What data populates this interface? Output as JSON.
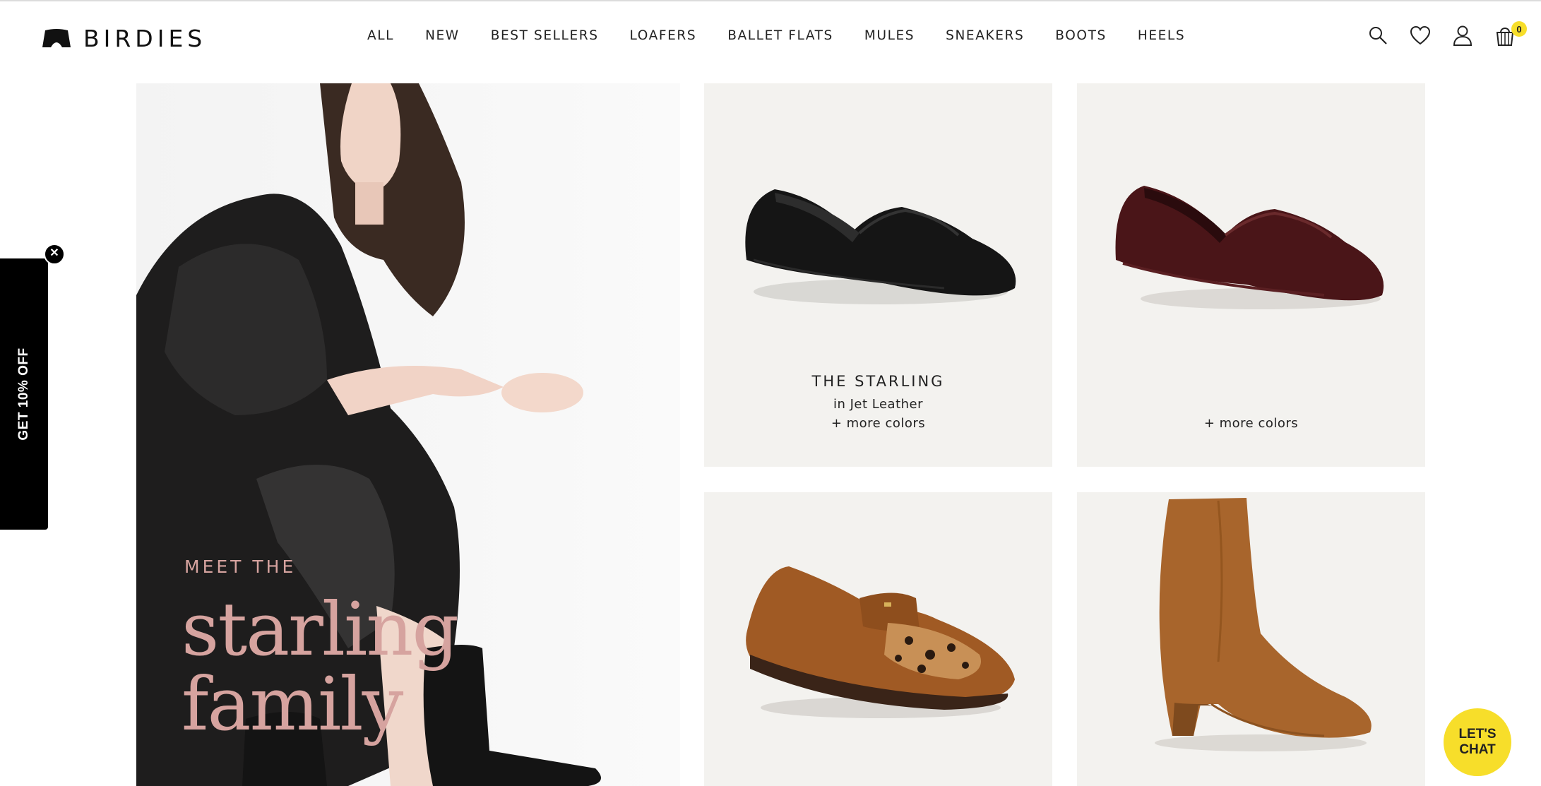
{
  "brand": {
    "name": "BIRDIES"
  },
  "nav": {
    "items": [
      "ALL",
      "NEW",
      "BEST SELLERS",
      "LOAFERS",
      "BALLET FLATS",
      "MULES",
      "SNEAKERS",
      "BOOTS",
      "HEELS"
    ]
  },
  "header_icons": {
    "search": "search-icon",
    "wishlist": "heart-icon",
    "account": "user-icon",
    "cart": "cart-icon",
    "cart_count": "0"
  },
  "hero": {
    "kicker": "MEET THE",
    "title_line1": "starling",
    "title_line2": "family"
  },
  "products": [
    {
      "name": "THE STARLING",
      "variant": "in Jet Leather",
      "more": "+ more colors"
    },
    {
      "name": "",
      "variant": "",
      "more": "+ more colors"
    },
    {
      "name": "",
      "variant": "",
      "more": ""
    },
    {
      "name": "",
      "variant": "",
      "more": ""
    }
  ],
  "promo": {
    "label": "GET 10% OFF",
    "close": "✕"
  },
  "chat": {
    "line1": "LET'S",
    "line2": "CHAT"
  },
  "colors": {
    "accent_yellow": "#f7de2a",
    "hero_text": "#d6a39f",
    "tile_bg": "#f3f2ef"
  }
}
